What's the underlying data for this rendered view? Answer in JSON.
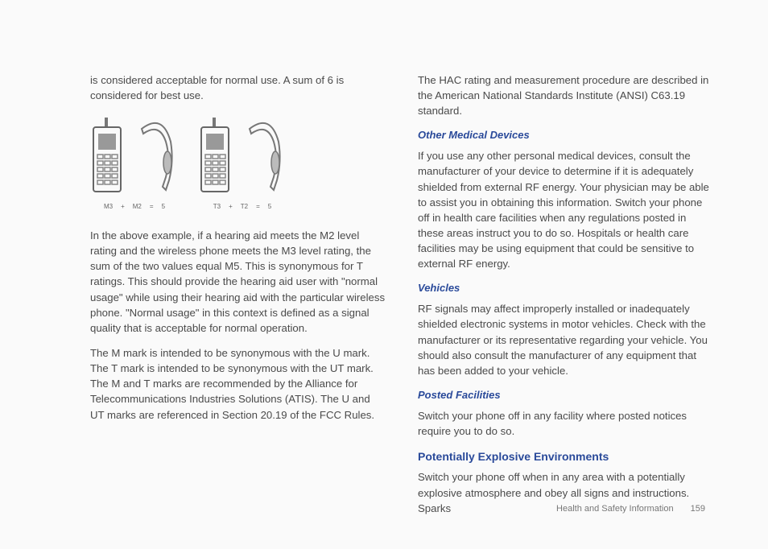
{
  "left": {
    "p1": "is considered acceptable for normal use. A sum of 6 is considered for best use.",
    "p2": "In the above example, if a hearing aid meets the M2 level rating and the wireless phone meets the M3 level rating, the sum of the two values equal M5. This is synonymous for T ratings. This should provide the hearing aid user with \"normal usage\" while using their hearing aid with the particular wireless phone. \"Normal usage\" in this context is defined as a signal quality that is acceptable for normal operation.",
    "p3": "The M mark is intended to be synonymous with the U mark. The T mark is intended to be synonymous with the UT mark. The M and T marks are recommended by the Alliance for Telecommunications Industries Solutions (ATIS). The U and UT marks are referenced in Section 20.19 of the FCC Rules."
  },
  "figure": {
    "eq1": {
      "a": "M3",
      "op1": "+",
      "b": "M2",
      "op2": "=",
      "c": "5"
    },
    "eq2": {
      "a": "T3",
      "op1": "+",
      "b": "T2",
      "op2": "=",
      "c": "5"
    }
  },
  "right": {
    "p1": "The HAC rating and measurement procedure are described in the American National Standards Institute (ANSI) C63.19 standard.",
    "h1": "Other Medical Devices",
    "p2": "If you use any other personal medical devices, consult the manufacturer of your device to determine if it is adequately shielded from external RF energy. Your physician may be able to assist you in obtaining this information. Switch your phone off in health care facilities when any regulations posted in these areas instruct you to do so. Hospitals or health care facilities may be using equipment that could be sensitive to external RF energy.",
    "h2": "Vehicles",
    "p3": "RF signals may affect improperly installed or inadequately shielded electronic systems in motor vehicles. Check with the manufacturer or its representative regarding your vehicle. You should also consult the manufacturer of any equipment that has been added to your vehicle.",
    "h3": "Posted Facilities",
    "p4": "Switch your phone off in any facility where posted notices require you to do so.",
    "h4": "Potentially Explosive Environments",
    "p5": "Switch your phone off when in any area with a potentially explosive atmosphere and obey all signs and instructions. Sparks"
  },
  "footer": {
    "section": "Health and Safety Information",
    "page": "159"
  }
}
